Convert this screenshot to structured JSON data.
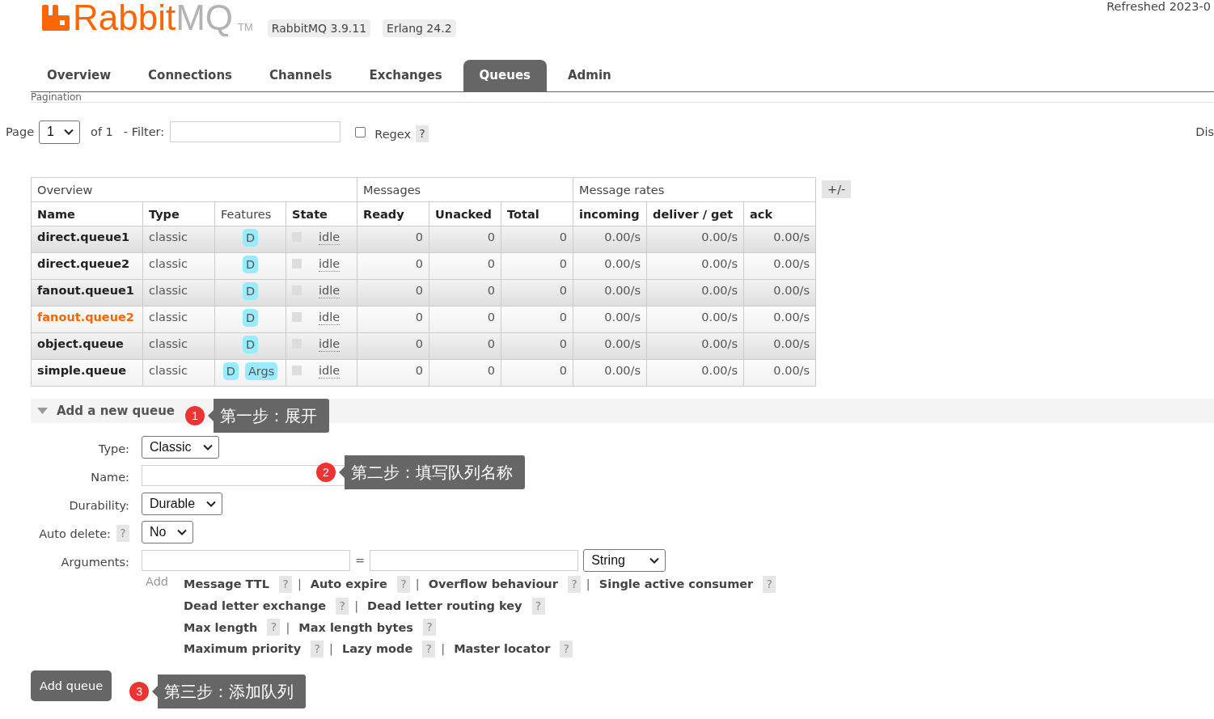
{
  "header": {
    "logo_primary": "Rabbit",
    "logo_secondary": "MQ",
    "trademark": "TM",
    "badges": [
      "RabbitMQ 3.9.11",
      "Erlang 24.2"
    ],
    "refreshed": "Refreshed 2023-0"
  },
  "tabs": [
    {
      "label": "Overview",
      "selected": false
    },
    {
      "label": "Connections",
      "selected": false
    },
    {
      "label": "Channels",
      "selected": false
    },
    {
      "label": "Exchanges",
      "selected": false
    },
    {
      "label": "Queues",
      "selected": true
    },
    {
      "label": "Admin",
      "selected": false
    }
  ],
  "pagination": {
    "heading": "Pagination",
    "page_label": "Page",
    "page_value": "1",
    "page_count": "of 1",
    "filter_label": "- Filter:",
    "regex": {
      "label": "Regex",
      "checked": false,
      "help": "?"
    },
    "side_text": "Dis"
  },
  "queues_table": {
    "column_groups": [
      {
        "label": "Overview",
        "columns": [
          {
            "label": "Name",
            "kind": "name",
            "sortable": true
          },
          {
            "label": "Type",
            "kind": "type",
            "sortable": true
          },
          {
            "label": "Features",
            "kind": "features",
            "sortable": false
          },
          {
            "label": "State",
            "kind": "state",
            "sortable": true
          }
        ]
      },
      {
        "label": "Messages",
        "columns": [
          {
            "label": "Ready",
            "kind": "ready",
            "sortable": true
          },
          {
            "label": "Unacked",
            "kind": "unacked",
            "sortable": true
          },
          {
            "label": "Total",
            "kind": "total",
            "sortable": true
          }
        ]
      },
      {
        "label": "Message rates",
        "columns": [
          {
            "label": "incoming",
            "kind": "incoming",
            "sortable": true
          },
          {
            "label": "deliver / get",
            "kind": "deliver_get",
            "sortable": true
          },
          {
            "label": "ack",
            "kind": "ack",
            "sortable": true
          }
        ]
      }
    ],
    "rows": [
      {
        "name": "direct.queue1",
        "highlighted": false,
        "type": "classic",
        "features": [
          "D"
        ],
        "state": "idle",
        "ready": "0",
        "unacked": "0",
        "total": "0",
        "incoming": "0.00/s",
        "deliver_get": "0.00/s",
        "ack": "0.00/s"
      },
      {
        "name": "direct.queue2",
        "highlighted": false,
        "type": "classic",
        "features": [
          "D"
        ],
        "state": "idle",
        "ready": "0",
        "unacked": "0",
        "total": "0",
        "incoming": "0.00/s",
        "deliver_get": "0.00/s",
        "ack": "0.00/s"
      },
      {
        "name": "fanout.queue1",
        "highlighted": false,
        "type": "classic",
        "features": [
          "D"
        ],
        "state": "idle",
        "ready": "0",
        "unacked": "0",
        "total": "0",
        "incoming": "0.00/s",
        "deliver_get": "0.00/s",
        "ack": "0.00/s"
      },
      {
        "name": "fanout.queue2",
        "highlighted": true,
        "type": "classic",
        "features": [
          "D"
        ],
        "state": "idle",
        "ready": "0",
        "unacked": "0",
        "total": "0",
        "incoming": "0.00/s",
        "deliver_get": "0.00/s",
        "ack": "0.00/s"
      },
      {
        "name": "object.queue",
        "highlighted": false,
        "type": "classic",
        "features": [
          "D"
        ],
        "state": "idle",
        "ready": "0",
        "unacked": "0",
        "total": "0",
        "incoming": "0.00/s",
        "deliver_get": "0.00/s",
        "ack": "0.00/s"
      },
      {
        "name": "simple.queue",
        "highlighted": false,
        "type": "classic",
        "features": [
          "D",
          "Args"
        ],
        "state": "idle",
        "ready": "0",
        "unacked": "0",
        "total": "0",
        "incoming": "0.00/s",
        "deliver_get": "0.00/s",
        "ack": "0.00/s"
      }
    ],
    "columns_toggle": "+/-"
  },
  "add_queue": {
    "title": "Add a new queue",
    "expanded": true,
    "callout": {
      "number": "1",
      "text": "第一步：展开"
    },
    "fields": [
      {
        "kind": "select",
        "label": "Type:",
        "value": "Classic"
      },
      {
        "kind": "input",
        "label": "Name:",
        "callout": {
          "number": "2",
          "text": "第二步：填写队列名称"
        }
      },
      {
        "kind": "select",
        "label": "Durability:",
        "value": "Durable"
      },
      {
        "kind": "select",
        "label": "Auto delete:",
        "help": "?",
        "value": "No"
      },
      {
        "kind": "arguments",
        "label": "Arguments:",
        "separator": "=",
        "value_type": "String"
      }
    ],
    "add_label": "Add",
    "argument_lines": [
      [
        {
          "label": "Message TTL",
          "help": "?",
          "separator": "|"
        },
        {
          "label": "Auto expire",
          "help": "?",
          "separator": "|"
        },
        {
          "label": "Overflow behaviour",
          "help": "?",
          "separator": "|"
        },
        {
          "label": "Single active consumer",
          "help": "?"
        }
      ],
      [
        {
          "label": "Dead letter exchange",
          "help": "?",
          "separator": "|"
        },
        {
          "label": "Dead letter routing key",
          "help": "?"
        }
      ],
      [
        {
          "label": "Max length",
          "help": "?",
          "separator": "|"
        },
        {
          "label": "Max length bytes",
          "help": "?"
        }
      ],
      [
        {
          "label": "Maximum priority",
          "help": "?",
          "separator": "|"
        },
        {
          "label": "Lazy mode",
          "help": "?",
          "separator": "|"
        },
        {
          "label": "Master locator",
          "help": "?"
        }
      ]
    ],
    "submit": {
      "label": "Add queue",
      "callout": {
        "number": "3",
        "text": "第三步：添加队列"
      }
    }
  }
}
